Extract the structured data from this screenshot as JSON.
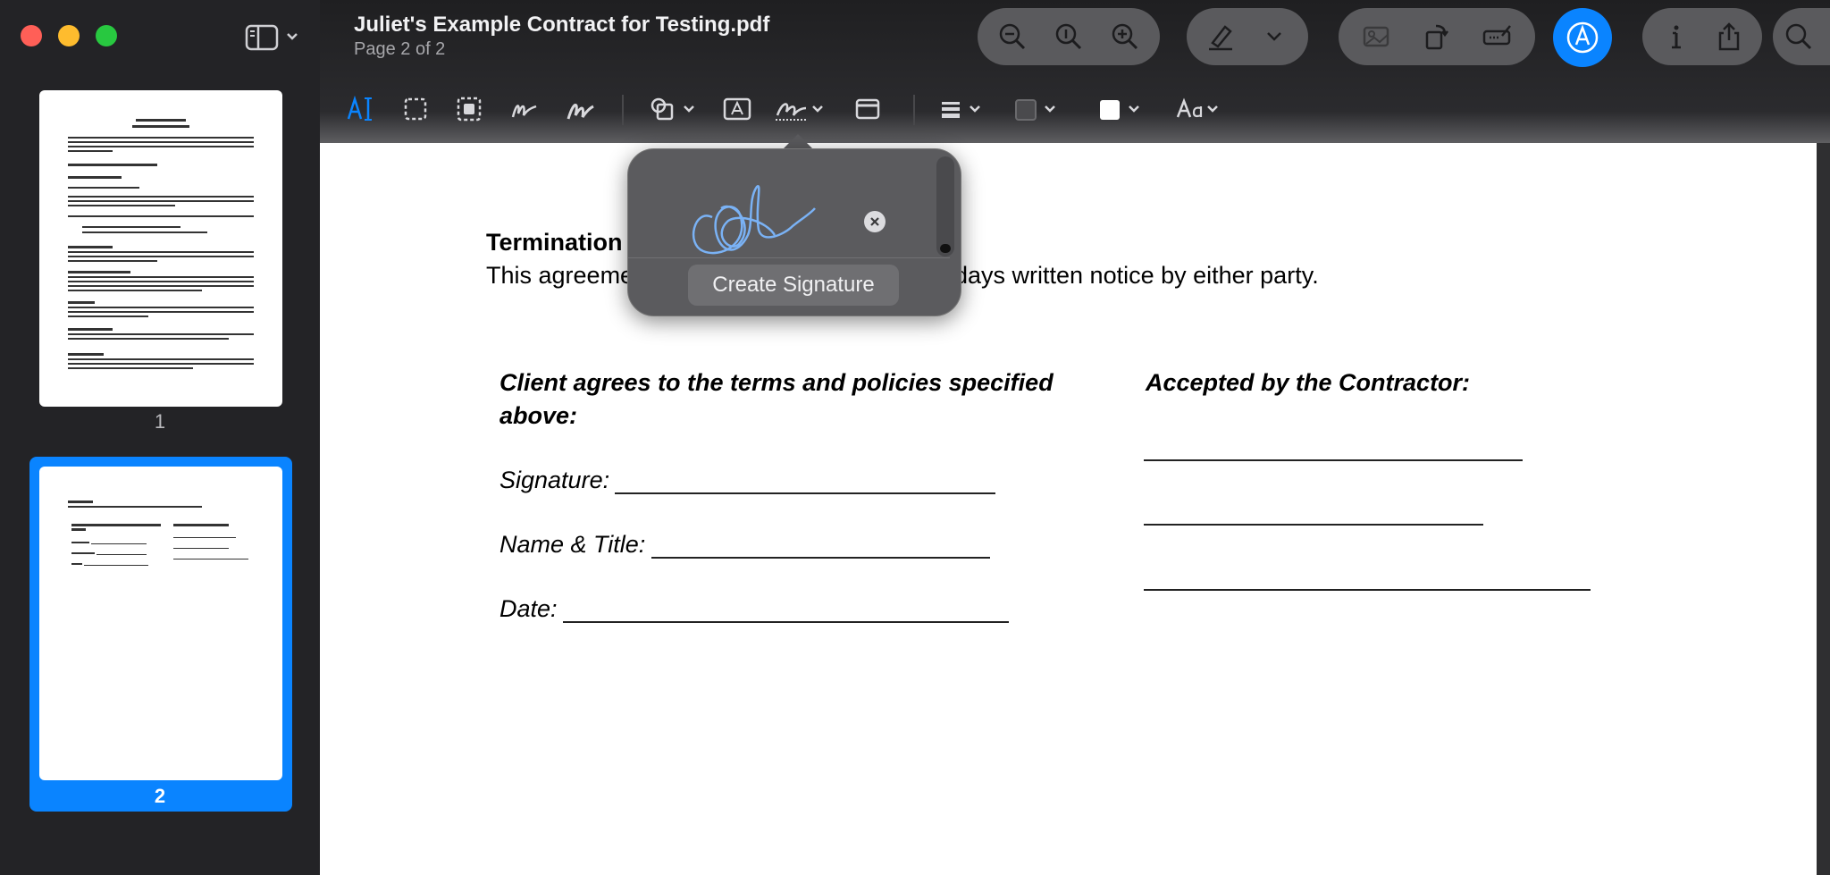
{
  "window": {
    "title": "Juliet's Example Contract for Testing.pdf",
    "subtitle": "Page 2 of 2"
  },
  "sidebar": {
    "pages": [
      {
        "number": "1",
        "selected": false
      },
      {
        "number": "2",
        "selected": true
      }
    ]
  },
  "popover": {
    "create_label": "Create Signature"
  },
  "document": {
    "termination_heading": "Termination",
    "termination_left": "This agreeme",
    "termination_right": "days written notice by either party.",
    "client_heading_1": "Client agrees to the terms and policies specified",
    "client_heading_2": "above:",
    "contractor_heading": "Accepted by the Contractor:",
    "signature_label": "Signature:",
    "name_label": "Name & Title:",
    "date_label": "Date:"
  },
  "colors": {
    "accent": "#0a84ff",
    "signature_ink": "#7ab2f5"
  }
}
